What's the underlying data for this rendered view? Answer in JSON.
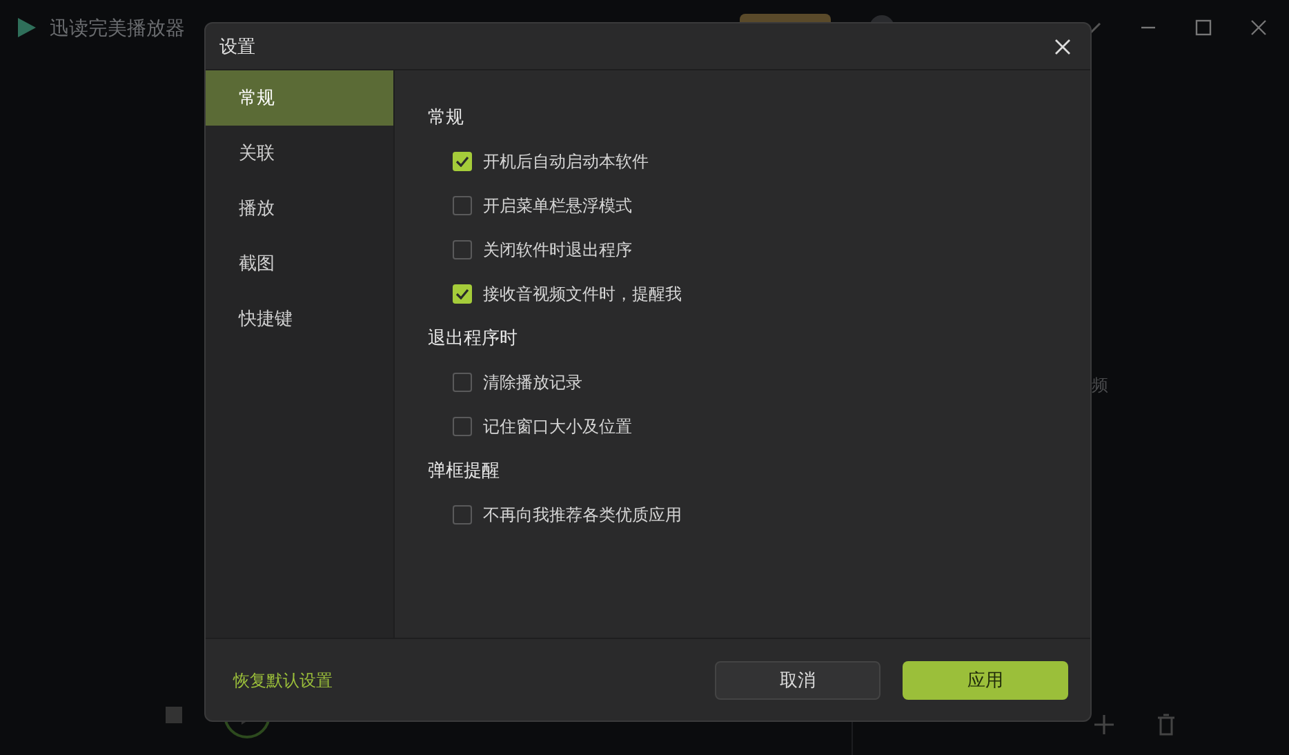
{
  "app": {
    "title": "迅读完美播放器",
    "side_text": "频"
  },
  "dialog": {
    "title": "设置",
    "sidebar": [
      {
        "label": "常规",
        "selected": true
      },
      {
        "label": "关联",
        "selected": false
      },
      {
        "label": "播放",
        "selected": false
      },
      {
        "label": "截图",
        "selected": false
      },
      {
        "label": "快捷键",
        "selected": false
      }
    ],
    "sections": [
      {
        "heading": "常规",
        "options": [
          {
            "label": "开机后自动启动本软件",
            "checked": true
          },
          {
            "label": "开启菜单栏悬浮模式",
            "checked": false
          },
          {
            "label": "关闭软件时退出程序",
            "checked": false
          },
          {
            "label": "接收音视频文件时，提醒我",
            "checked": true
          }
        ]
      },
      {
        "heading": "退出程序时",
        "options": [
          {
            "label": "清除播放记录",
            "checked": false
          },
          {
            "label": "记住窗口大小及位置",
            "checked": false
          }
        ]
      },
      {
        "heading": "弹框提醒",
        "options": [
          {
            "label": "不再向我推荐各类优质应用",
            "checked": false
          }
        ]
      }
    ],
    "reset_link": "恢复默认设置",
    "cancel": "取消",
    "apply": "应用"
  }
}
